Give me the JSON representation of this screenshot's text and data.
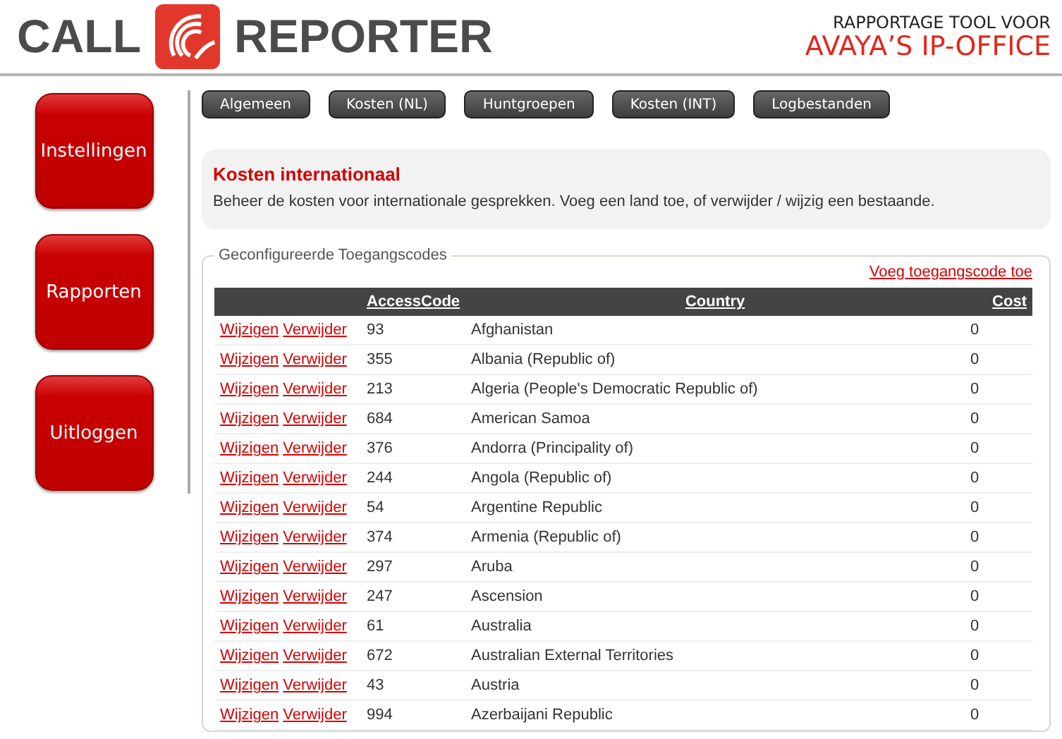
{
  "header": {
    "logo_left": "CALL",
    "logo_right": "REPORTER",
    "tagline": "RAPPORTAGE TOOL VOOR",
    "product": "AVAYA’S IP-OFFICE"
  },
  "sidebar": {
    "items": [
      {
        "label": "Instellingen"
      },
      {
        "label": "Rapporten"
      },
      {
        "label": "Uitloggen"
      }
    ]
  },
  "tabs": [
    {
      "label": "Algemeen"
    },
    {
      "label": "Kosten (NL)"
    },
    {
      "label": "Huntgroepen"
    },
    {
      "label": "Kosten (INT)"
    },
    {
      "label": "Logbestanden"
    }
  ],
  "info": {
    "title": "Kosten internationaal",
    "text": "Beheer de kosten voor internationale gesprekken. Voeg een land toe, of verwijder / wijzig een bestaande."
  },
  "fieldset": {
    "legend": "Geconfigureerde Toegangscodes",
    "add_link": "Voeg toegangscode toe"
  },
  "table": {
    "columns": [
      "AccessCode",
      "Country",
      "Cost"
    ],
    "rows": [
      {
        "edit": "Wijzigen",
        "delete": "Verwijder",
        "code": "93",
        "country": "Afghanistan",
        "cost": "0"
      },
      {
        "edit": "Wijzigen",
        "delete": "Verwijder",
        "code": "355",
        "country": "Albania (Republic of)",
        "cost": "0"
      },
      {
        "edit": "Wijzigen",
        "delete": "Verwijder",
        "code": "213",
        "country": "Algeria (People's Democratic Republic of)",
        "cost": "0"
      },
      {
        "edit": "Wijzigen",
        "delete": "Verwijder",
        "code": "684",
        "country": "American Samoa",
        "cost": "0"
      },
      {
        "edit": "Wijzigen",
        "delete": "Verwijder",
        "code": "376",
        "country": "Andorra (Principality of)",
        "cost": "0"
      },
      {
        "edit": "Wijzigen",
        "delete": "Verwijder",
        "code": "244",
        "country": "Angola (Republic of)",
        "cost": "0"
      },
      {
        "edit": "Wijzigen",
        "delete": "Verwijder",
        "code": "54",
        "country": "Argentine Republic",
        "cost": "0"
      },
      {
        "edit": "Wijzigen",
        "delete": "Verwijder",
        "code": "374",
        "country": "Armenia (Republic of)",
        "cost": "0"
      },
      {
        "edit": "Wijzigen",
        "delete": "Verwijder",
        "code": "297",
        "country": "Aruba",
        "cost": "0"
      },
      {
        "edit": "Wijzigen",
        "delete": "Verwijder",
        "code": "247",
        "country": "Ascension",
        "cost": "0"
      },
      {
        "edit": "Wijzigen",
        "delete": "Verwijder",
        "code": "61",
        "country": "Australia",
        "cost": "0"
      },
      {
        "edit": "Wijzigen",
        "delete": "Verwijder",
        "code": "672",
        "country": "Australian External Territories",
        "cost": "0"
      },
      {
        "edit": "Wijzigen",
        "delete": "Verwijder",
        "code": "43",
        "country": "Austria",
        "cost": "0"
      },
      {
        "edit": "Wijzigen",
        "delete": "Verwijder",
        "code": "994",
        "country": "Azerbaijani Republic",
        "cost": "0"
      }
    ]
  }
}
